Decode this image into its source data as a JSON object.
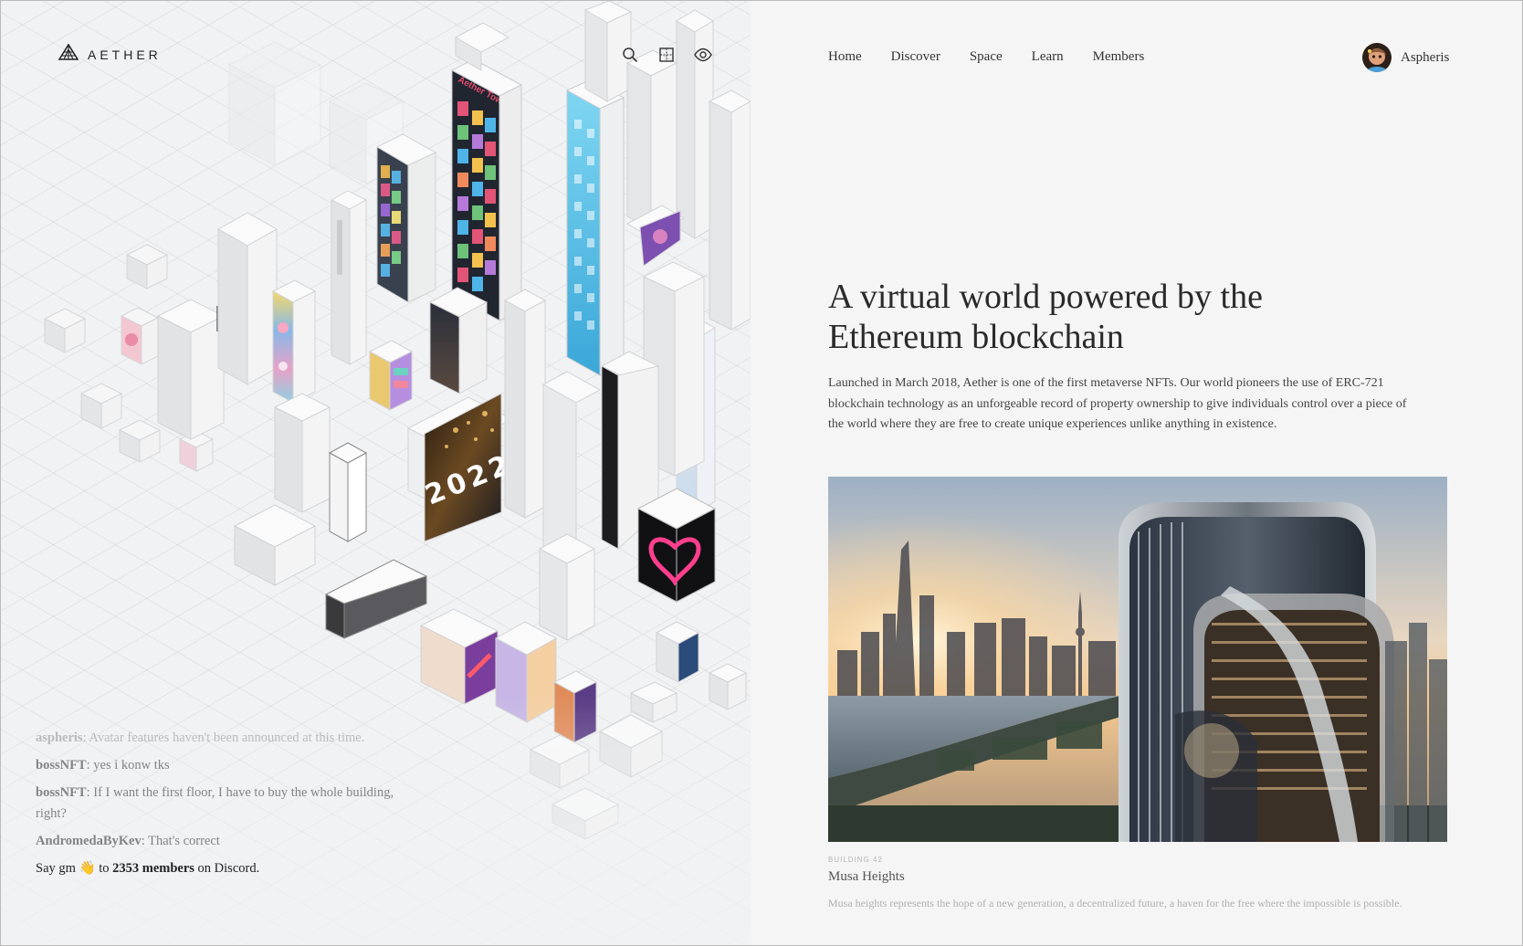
{
  "brand": {
    "name": "AETHER",
    "logo_icon": "aether-logo-icon"
  },
  "toolbar": {
    "icons": [
      "search-icon",
      "grid-icon",
      "eye-icon"
    ]
  },
  "nav": {
    "items": [
      {
        "label": "Home"
      },
      {
        "label": "Discover"
      },
      {
        "label": "Space"
      },
      {
        "label": "Learn"
      },
      {
        "label": "Members"
      }
    ]
  },
  "user": {
    "name": "Aspheris"
  },
  "hero": {
    "title": "A virtual world powered by the Ethereum blockchain",
    "description": "Launched in March 2018, Aether is one of the first metaverse NFTs. Our world pioneers the use of ERC-721 blockchain technology as an unforgeable record of property ownership to give individuals control over a piece of the world where they are free to create unique experiences unlike anything in existence."
  },
  "city_panels": {
    "tower_sign": "Aether Tower",
    "year_billboard": "2022"
  },
  "chat": {
    "messages": [
      {
        "user": "aspheris",
        "text": ": Avatar features haven't been announced at this time."
      },
      {
        "user": "bossNFT",
        "text": ": yes i konw tks"
      },
      {
        "user": "bossNFT",
        "text": ": If I want the first floor, I have to buy the whole building, right?"
      },
      {
        "user": "AndromedaByKev",
        "text": ": That's correct"
      }
    ],
    "cta_prefix": "Say gm",
    "cta_emoji": "👋",
    "cta_to": "to",
    "cta_count": "2353 members",
    "cta_suffix": "on Discord."
  },
  "building": {
    "label": "BUILDING 42",
    "name": "Musa Heights",
    "description": "Musa heights represents the hope of a new generation, a decentralized future, a haven for the free where the impossible is possible."
  },
  "colors": {
    "accent_pink": "#ff3f8e",
    "screen_blue": "#5cc6ea",
    "panel_bg": "#f5f5f5",
    "text_dark": "#2a2a2a"
  }
}
